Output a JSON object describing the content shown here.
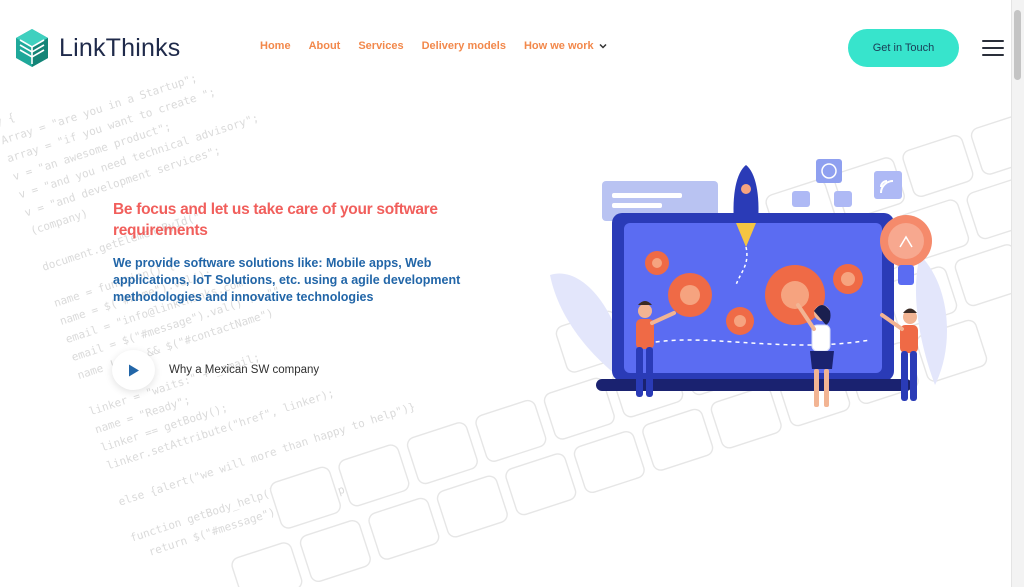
{
  "brand": {
    "name": "LinkThinks"
  },
  "nav": {
    "items": [
      {
        "label": "Home"
      },
      {
        "label": "About"
      },
      {
        "label": "Services"
      },
      {
        "label": "Delivery models"
      },
      {
        "label": "How we work"
      }
    ]
  },
  "cta": {
    "label": "Get in Touch"
  },
  "hero": {
    "title": "Be focus and let us take care of your software requirements",
    "subtitle": "We provide software solutions like: Mobile apps, Web applications, IoT Solutions, etc. using a agile development methodologies and innovative technologies",
    "video_label": "Why a Mexican SW company"
  },
  "background_code": [
    "try {",
    "  Array = \"are you in a Startup\";",
    "  array = \"if you want to create \";",
    "  v = \"an awesome product\";",
    "  v = \"and you need technical advisory\";",
    "  v = \"and development services\";",
    "  (company)",
    "",
    "  document.getElementById(\"",
    "",
    "  name = function() {",
    "  name = $(\"#name\").val();",
    "  email = \"info@linkthinks.com\";",
    "  email = $(\"#message\").val() != \"\"",
    "  name != \"\" && $(\"#contactName\")",
    "",
    "  linker = \"waits:\" + _email;",
    "  name = \"Ready\";",
    "  linker == getBody();",
    "  linker.setAttribute(\"href\", linker);",
    "",
    "  else {alert(\"we will more than happy to help\")}",
    "",
    "  function getBody_help() {",
    "    return $(\"#message\").val() + \"p\";"
  ],
  "colors": {
    "accent_orange": "#f2884b",
    "title_coral": "#f15f5c",
    "subtitle_blue": "#2266a8",
    "cta_teal": "#37e4cc",
    "logo_teal": "#1fa89a",
    "logo_navy": "#1f2a4a"
  },
  "icons": {
    "logo": "cube-logo-icon",
    "dropdown": "chevron-down-icon",
    "menu": "hamburger-menu-icon",
    "play": "play-icon"
  }
}
